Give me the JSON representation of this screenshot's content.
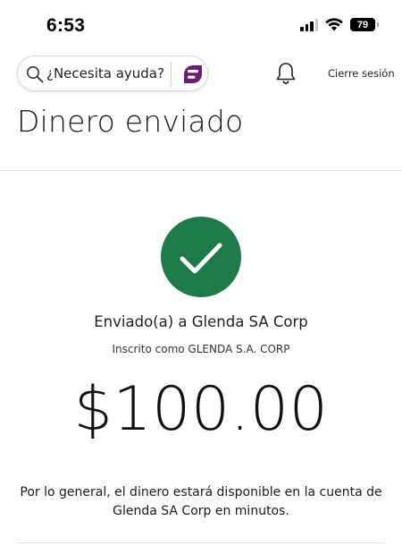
{
  "status_bar": {
    "time": "6:53",
    "battery_level": "79",
    "icons": [
      "signal-icon",
      "wifi-icon",
      "battery-icon"
    ]
  },
  "header": {
    "search": {
      "label": "¿Necesita ayuda?",
      "icon": "search-icon"
    },
    "assistant_icon": "assistant-icon",
    "notifications_icon": "bell-icon",
    "signout_label": "Cierre sesión"
  },
  "page": {
    "title": "Dinero enviado"
  },
  "confirmation": {
    "status_icon": "checkmark-icon",
    "sent_to": "Enviado(a) a Glenda SA Corp",
    "registered_as": "Inscrito como GLENDA S.A. CORP",
    "amount": "$100.00",
    "availability_note": "Por lo general, el dinero estará disponible en la cuenta de Glenda SA Corp en minutos."
  },
  "colors": {
    "success_green": "#1f7a4a",
    "assistant_purple": "#6b1f74",
    "divider": "#e3e3e3"
  }
}
